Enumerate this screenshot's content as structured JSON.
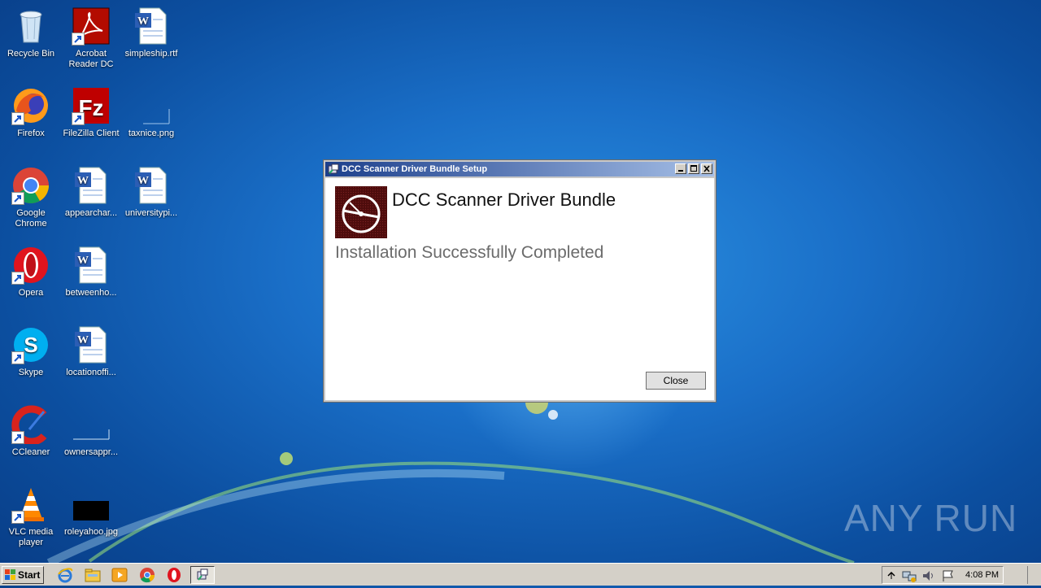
{
  "desktop": {
    "icons": [
      {
        "label": "Recycle Bin"
      },
      {
        "label": "Acrobat Reader DC"
      },
      {
        "label": "simpleship.rtf"
      },
      {
        "label": "Firefox"
      },
      {
        "label": "FileZilla Client"
      },
      {
        "label": "taxnice.png"
      },
      {
        "label": "Google Chrome"
      },
      {
        "label": "appearchar..."
      },
      {
        "label": "universitypi..."
      },
      {
        "label": "Opera"
      },
      {
        "label": "betweenho..."
      },
      {
        "label": "Skype"
      },
      {
        "label": "locationoffi..."
      },
      {
        "label": "CCleaner"
      },
      {
        "label": "ownersappr..."
      },
      {
        "label": "VLC media player"
      },
      {
        "label": "roleyahoo.jpg"
      }
    ],
    "watermark": "ANY RUN"
  },
  "dialog": {
    "title": "DCC Scanner Driver Bundle Setup",
    "app_name": "DCC Scanner Driver Bundle",
    "status": "Installation Successfully Completed",
    "close_label": "Close"
  },
  "taskbar": {
    "start_label": "Start",
    "clock": "4:08 PM",
    "pinned": [
      "ie-icon",
      "explorer-icon",
      "media-player-icon",
      "chrome-icon",
      "opera-icon",
      "setup-icon"
    ]
  },
  "colors": {
    "desktop_blue": "#1a6fc8",
    "title_bar": "#1c3f8c",
    "logo_red": "#5a0f0f"
  }
}
